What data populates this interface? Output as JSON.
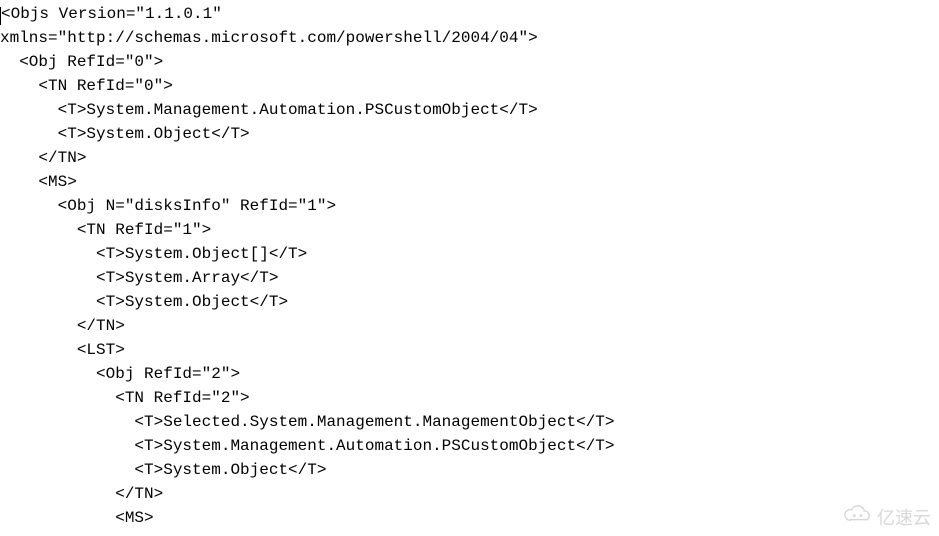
{
  "code": {
    "lines": [
      "<Objs Version=\"1.1.0.1\"",
      "xmlns=\"http://schemas.microsoft.com/powershell/2004/04\">",
      "  <Obj RefId=\"0\">",
      "    <TN RefId=\"0\">",
      "      <T>System.Management.Automation.PSCustomObject</T>",
      "      <T>System.Object</T>",
      "    </TN>",
      "    <MS>",
      "      <Obj N=\"disksInfo\" RefId=\"1\">",
      "        <TN RefId=\"1\">",
      "          <T>System.Object[]</T>",
      "          <T>System.Array</T>",
      "          <T>System.Object</T>",
      "        </TN>",
      "        <LST>",
      "          <Obj RefId=\"2\">",
      "            <TN RefId=\"2\">",
      "              <T>Selected.System.Management.ManagementObject</T>",
      "              <T>System.Management.Automation.PSCustomObject</T>",
      "              <T>System.Object</T>",
      "            </TN>",
      "            <MS>"
    ]
  },
  "watermark": {
    "text": "亿速云"
  }
}
